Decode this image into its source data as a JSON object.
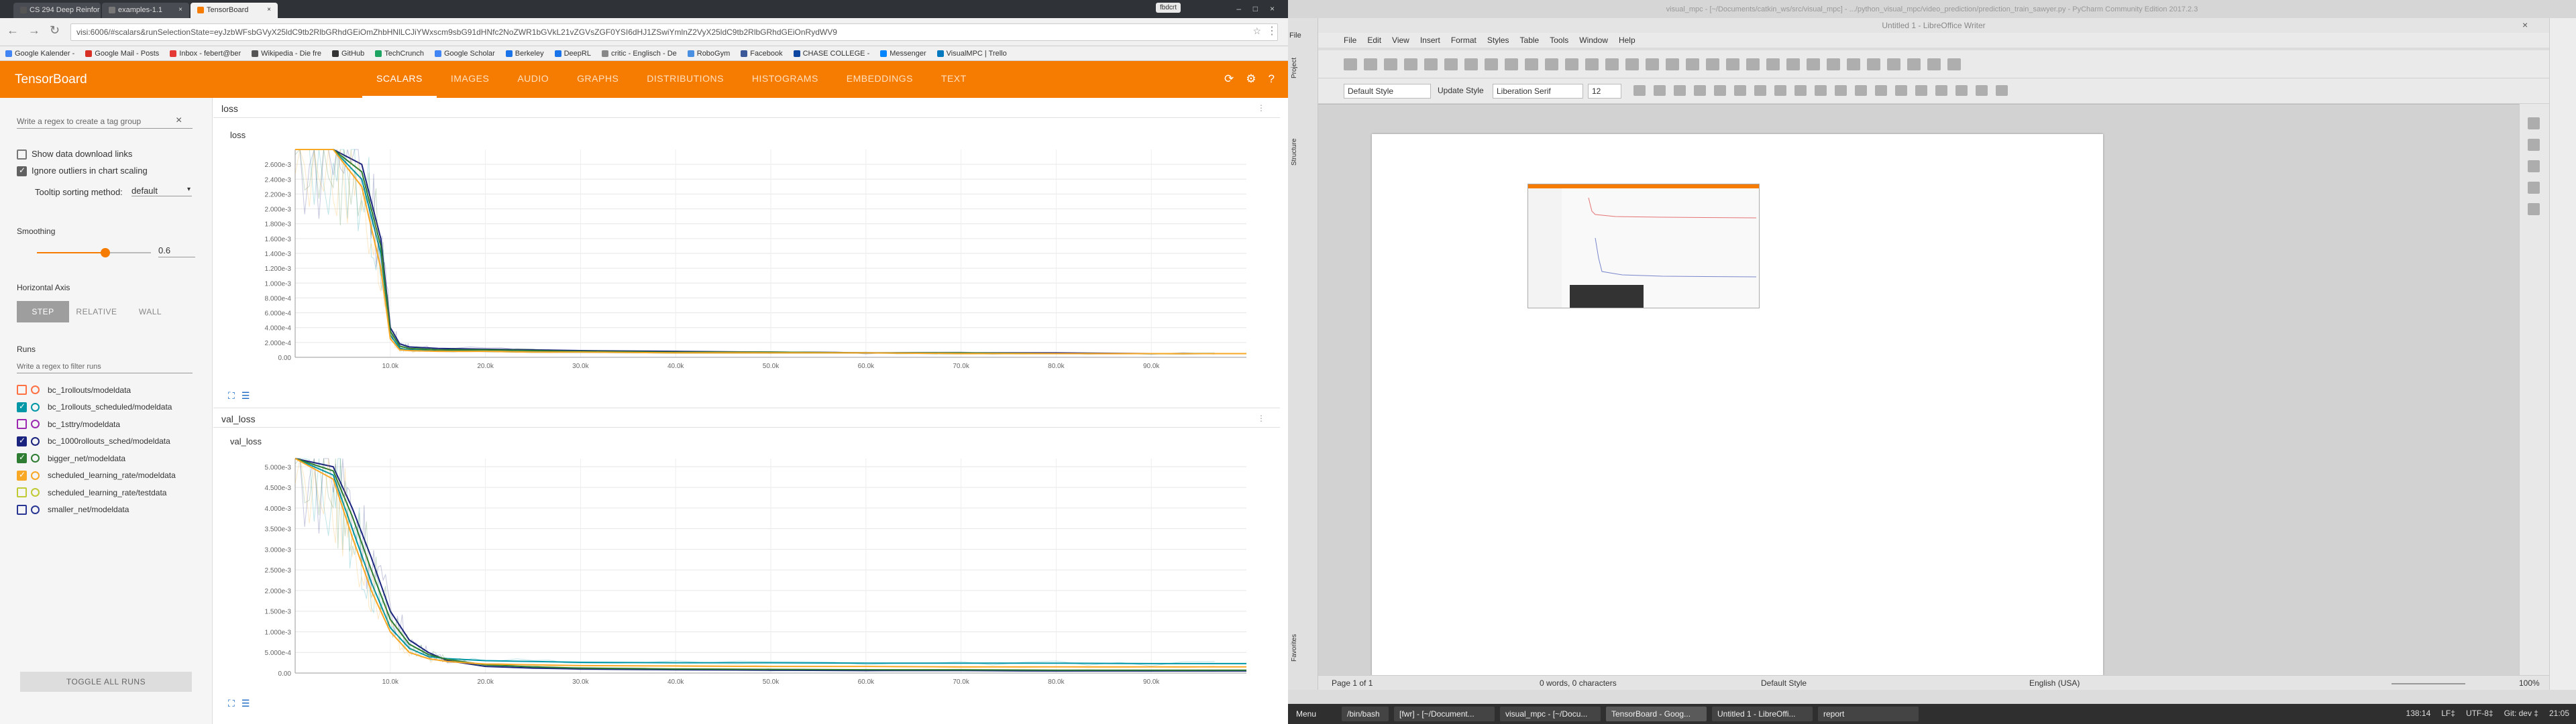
{
  "browser": {
    "tabs": [
      {
        "title": "CS 294 Deep Reinfor"
      },
      {
        "title": "examples-1.1"
      },
      {
        "title": "TensorBoard"
      }
    ],
    "profile": "fbdcrt",
    "url": "visi:6006/#scalars&runSelectionState=eyJzbWFsbGVyX25ldC9tb2RlbGRhdGEiOmZhbHNlLCJiYWxscm9sbG91dHNfc2NoZWR1bGVkL21vZGVsZGF0YSI6dHJ1ZSwiYmlnZ2VyX25ldC9tb2RlbGRhdGEiOnRydWV9",
    "bookmarks": [
      "Google Kalender -",
      "Google Mail - Posts",
      "Inbox - febert@ber",
      "Wikipedia - Die fre",
      "GitHub",
      "TechCrunch",
      "Google Scholar",
      "Berkeley",
      "DeepRL",
      "critic - Englisch - De",
      "RoboGym",
      "Facebook",
      "CHASE COLLEGE -",
      "Messenger",
      "VisualMPC | Trello"
    ]
  },
  "tensorboard": {
    "title": "TensorBoard",
    "nav": [
      "SCALARS",
      "IMAGES",
      "AUDIO",
      "GRAPHS",
      "DISTRIBUTIONS",
      "HISTOGRAMS",
      "EMBEDDINGS",
      "TEXT"
    ],
    "active_tab": "SCALARS",
    "sidebar": {
      "tag_filter_placeholder": "Write a regex to create a tag group",
      "show_download_links": "Show data download links",
      "ignore_outliers": "Ignore outliers in chart scaling",
      "tooltip_label": "Tooltip sorting method:",
      "tooltip_value": "default",
      "smoothing_label": "Smoothing",
      "smoothing_value": "0.6",
      "smoothing_fraction": 0.6,
      "horizontal_axis_label": "Horizontal Axis",
      "axis_buttons": [
        "STEP",
        "RELATIVE",
        "WALL"
      ],
      "runs_label": "Runs",
      "runs_filter_placeholder": "Write a regex to filter runs",
      "runs": [
        {
          "name": "bc_1rollouts/modeldata",
          "color": "#ff7043",
          "checked": false
        },
        {
          "name": "bc_1rollouts_scheduled/modeldata",
          "color": "#0097a7",
          "checked": true
        },
        {
          "name": "bc_1sttry/modeldata",
          "color": "#9c27b0",
          "checked": false
        },
        {
          "name": "bc_1000rollouts_sched/modeldata",
          "color": "#1a237e",
          "checked": true
        },
        {
          "name": "bigger_net/modeldata",
          "color": "#2e7d32",
          "checked": true
        },
        {
          "name": "scheduled_learning_rate/modeldata",
          "color": "#f9a825",
          "checked": true
        },
        {
          "name": "scheduled_learning_rate/testdata",
          "color": "#c0ca33",
          "checked": false
        },
        {
          "name": "smaller_net/modeldata",
          "color": "#283593",
          "checked": false
        }
      ],
      "toggle_all": "TOGGLE ALL RUNS"
    }
  },
  "chart_data": [
    {
      "type": "line",
      "title": "loss",
      "ylim": [
        0,
        0.0028
      ],
      "xlim": [
        0,
        100000
      ],
      "y_ticks": [
        "0.00",
        "2.000e-4",
        "4.000e-4",
        "6.000e-4",
        "8.000e-4",
        "1.000e-3",
        "1.200e-3",
        "1.400e-3",
        "1.600e-3",
        "1.800e-3",
        "2.000e-3",
        "2.200e-3",
        "2.400e-3",
        "2.600e-3"
      ],
      "x_ticks": [
        "10.0k",
        "20.0k",
        "30.0k",
        "40.0k",
        "50.0k",
        "60.0k",
        "70.0k",
        "80.0k",
        "90.0k"
      ],
      "x": [
        0,
        4000,
        7000,
        9000,
        10000,
        11000,
        12000,
        15000,
        20000,
        25000,
        30000,
        40000,
        50000,
        60000,
        70000,
        80000,
        90000,
        100000
      ],
      "series": [
        {
          "color": "#0097a7",
          "values": [
            0.0028,
            0.0028,
            0.0024,
            0.0014,
            0.0003,
            0.00012,
            0.0001,
            9e-05,
            8e-05,
            7e-05,
            7e-05,
            6e-05,
            6e-05,
            6e-05,
            5e-05,
            5e-05,
            5e-05,
            5e-05
          ]
        },
        {
          "color": "#1a237e",
          "values": [
            0.0028,
            0.0028,
            0.0026,
            0.0016,
            0.0004,
            0.00018,
            0.00014,
            0.00012,
            0.00011,
            0.0001,
            9e-05,
            8e-05,
            7e-05,
            6e-05,
            6e-05,
            6e-05,
            5e-05,
            5e-05
          ]
        },
        {
          "color": "#2e7d32",
          "values": [
            0.0028,
            0.0028,
            0.0025,
            0.0015,
            0.00035,
            0.00015,
            0.00012,
            0.0001,
            0.0001,
            9e-05,
            8e-05,
            7e-05,
            7e-05,
            6e-05,
            6e-05,
            5e-05,
            5e-05,
            5e-05
          ]
        },
        {
          "color": "#f9a825",
          "values": [
            0.0028,
            0.0028,
            0.0023,
            0.0012,
            0.00025,
            0.0001,
            9e-05,
            8e-05,
            8e-05,
            7e-05,
            7e-05,
            6e-05,
            6e-05,
            6e-05,
            5e-05,
            5e-05,
            5e-05,
            5e-05
          ]
        }
      ]
    },
    {
      "type": "line",
      "title": "val_loss",
      "ylim": [
        0,
        0.0052
      ],
      "xlim": [
        0,
        100000
      ],
      "y_ticks": [
        "0.00",
        "5.000e-4",
        "1.000e-3",
        "1.500e-3",
        "2.000e-3",
        "2.500e-3",
        "3.000e-3",
        "3.500e-3",
        "4.000e-3",
        "4.500e-3",
        "5.000e-3"
      ],
      "x_ticks": [
        "10.0k",
        "20.0k",
        "30.0k",
        "40.0k",
        "50.0k",
        "60.0k",
        "70.0k",
        "80.0k",
        "90.0k"
      ],
      "x": [
        0,
        4000,
        6000,
        8000,
        10000,
        12000,
        14000,
        16000,
        20000,
        25000,
        30000,
        40000,
        50000,
        60000,
        70000,
        80000,
        90000,
        100000
      ],
      "series": [
        {
          "color": "#0097a7",
          "values": [
            0.0052,
            0.0048,
            0.0035,
            0.0022,
            0.0011,
            0.0006,
            0.0004,
            0.00035,
            0.0003,
            0.00028,
            0.00026,
            0.00025,
            0.00025,
            0.00024,
            0.00024,
            0.00024,
            0.00023,
            0.00023
          ]
        },
        {
          "color": "#1a237e",
          "values": [
            0.0052,
            0.005,
            0.004,
            0.0028,
            0.0015,
            0.0008,
            0.0005,
            0.0003,
            0.00016,
            0.00012,
            0.0001,
            8e-05,
            7e-05,
            6e-05,
            6e-05,
            5e-05,
            5e-05,
            5e-05
          ]
        },
        {
          "color": "#2e7d32",
          "values": [
            0.0052,
            0.0049,
            0.0038,
            0.0025,
            0.0013,
            0.0007,
            0.00045,
            0.00033,
            0.0002,
            0.00015,
            0.00012,
            0.0001,
            9e-05,
            8e-05,
            8e-05,
            7e-05,
            7e-05,
            7e-05
          ]
        },
        {
          "color": "#f9a825",
          "values": [
            0.0052,
            0.0047,
            0.0033,
            0.002,
            0.001,
            0.0005,
            0.00035,
            0.00028,
            0.00022,
            0.0002,
            0.00018,
            0.00017,
            0.00016,
            0.00016,
            0.00015,
            0.00015,
            0.00015,
            0.00015
          ]
        }
      ]
    }
  ],
  "libreoffice": {
    "top_title": "visual_mpc - [~/Documents/catkin_ws/src/visual_mpc] - .../python_visual_mpc/video_prediction/prediction_train_sawyer.py - PyCharm Community Edition 2017.2.3",
    "window_title": "Untitled 1 - LibreOffice Writer",
    "menu": [
      "File",
      "Edit",
      "View",
      "Insert",
      "Format",
      "Styles",
      "Table",
      "Tools",
      "Window",
      "Help"
    ],
    "paragraph_style": "Default Style",
    "update_style": "Update Style",
    "font_name": "Liberation Serif",
    "font_size": "12",
    "status_page": "Page 1 of 1",
    "status_words": "0 words, 0 characters",
    "status_style": "Default Style",
    "status_lang": "English (USA)",
    "zoom": "100%",
    "side_panels": [
      "Project",
      "Structure",
      "Favorites"
    ]
  },
  "taskbar": {
    "menu": "Menu",
    "items": [
      "/bin/bash",
      "[fwr] - [~/Document...",
      "visual_mpc - [~/Docu...",
      "TensorBoard - Goog...",
      "Untitled 1 - LibreOffi...",
      "report"
    ],
    "active": "TensorBoard - Goog...",
    "tray": [
      "138:14",
      "LF‡",
      "UTF-8‡",
      "Git: dev ‡"
    ],
    "clock": "21:05"
  }
}
